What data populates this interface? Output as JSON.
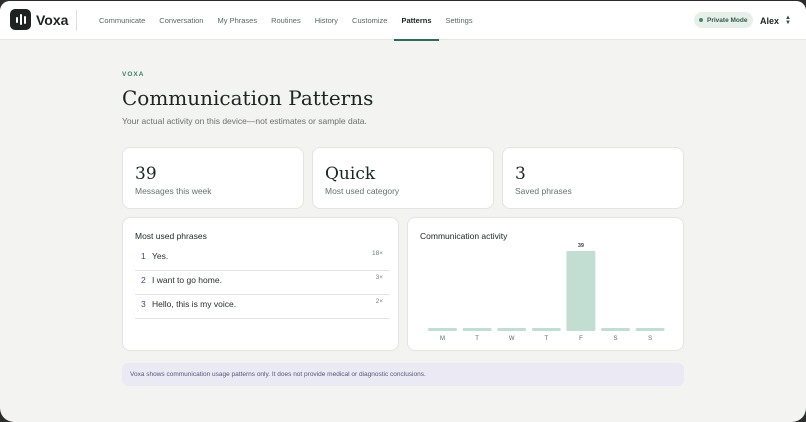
{
  "app": {
    "name": "Voxa",
    "private_mode_label": "Private Mode",
    "user_name": "Alex"
  },
  "nav": {
    "items": [
      {
        "label": "Communicate",
        "active": false
      },
      {
        "label": "Conversation",
        "active": false
      },
      {
        "label": "My Phrases",
        "active": false
      },
      {
        "label": "Routines",
        "active": false
      },
      {
        "label": "History",
        "active": false
      },
      {
        "label": "Customize",
        "active": false
      },
      {
        "label": "Patterns",
        "active": true
      },
      {
        "label": "Settings",
        "active": false
      }
    ]
  },
  "page": {
    "eyebrow": "VOXA",
    "title": "Communication Patterns",
    "subtitle": "Your actual activity on this device—not estimates or sample data."
  },
  "stats": [
    {
      "value": "39",
      "label": "Messages this week"
    },
    {
      "value": "Quick",
      "label": "Most used category"
    },
    {
      "value": "3",
      "label": "Saved phrases"
    }
  ],
  "phrases": {
    "title": "Most used phrases",
    "items": [
      {
        "rank": "1",
        "text": "Yes.",
        "count": "18×"
      },
      {
        "rank": "2",
        "text": "I want to go home.",
        "count": "3×"
      },
      {
        "rank": "3",
        "text": "Hello, this is my voice.",
        "count": "2×"
      }
    ]
  },
  "activity": {
    "title": "Communication activity"
  },
  "chart_data": {
    "type": "bar",
    "title": "Communication activity",
    "categories": [
      "M",
      "T",
      "W",
      "T",
      "F",
      "S",
      "S"
    ],
    "values": [
      0,
      0,
      0,
      0,
      39,
      0,
      0
    ],
    "data_labels": [
      "",
      "",
      "",
      "",
      "39",
      "",
      ""
    ],
    "xlabel": "",
    "ylabel": "",
    "ylim": [
      0,
      39
    ],
    "grid": false,
    "bar_color": "#c2ddd2"
  },
  "disclaimer": "Voxa shows communication usage patterns only. It does not provide medical or diagnostic conclusions.",
  "colors": {
    "accent": "#2f6b5a",
    "rank": "#3a4a8a",
    "disclaimer_bg": "#ebe9f4"
  }
}
